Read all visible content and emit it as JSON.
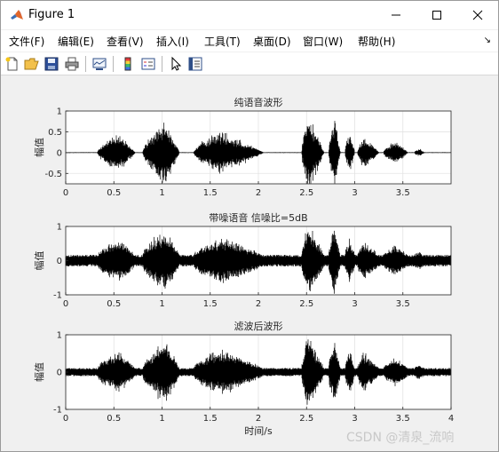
{
  "window": {
    "title": "Figure 1"
  },
  "menu": {
    "items": [
      "文件(F)",
      "编辑(E)",
      "查看(V)",
      "插入(I)",
      "工具(T)",
      "桌面(D)",
      "窗口(W)",
      "帮助(H)"
    ]
  },
  "toolbar": {
    "icons": [
      "new-figure-icon",
      "open-file-icon",
      "save-icon",
      "print-icon",
      "link-plot-icon",
      "insert-colorbar-icon",
      "insert-legend-icon",
      "pointer-icon",
      "property-inspector-icon"
    ]
  },
  "watermark": "CSDN @清泉_流响",
  "chart_data": [
    {
      "type": "line",
      "title": "纯语音波形",
      "xlabel": "",
      "ylabel": "幅值",
      "xlim": [
        0,
        4
      ],
      "ylim": [
        -0.75,
        1
      ],
      "xticks": [
        "0",
        "0.5",
        "1",
        "1.5",
        "2",
        "2.5",
        "3",
        "3.5"
      ],
      "yticks": [
        "1",
        "0.5",
        "0",
        "-0.5"
      ],
      "grid": true,
      "color": "#000000",
      "series": [
        {
          "noise": 0.01,
          "segments": [
            {
              "x": [
                0.33,
                0.72
              ],
              "amp": 0.5,
              "peak": 0.55
            },
            {
              "x": [
                0.8,
                1.18
              ],
              "amp": 0.8,
              "peak": 0.62
            },
            {
              "x": [
                1.33,
                2.05
              ],
              "amp": 0.55,
              "peak": 0.4
            },
            {
              "x": [
                2.45,
                2.68
              ],
              "amp": 0.98,
              "peak": 0.3
            },
            {
              "x": [
                2.73,
                2.85
              ],
              "amp": 0.9,
              "peak": 0.5
            },
            {
              "x": [
                2.9,
                3.0
              ],
              "amp": 0.55,
              "peak": 0.5
            },
            {
              "x": [
                3.03,
                3.25
              ],
              "amp": 0.45,
              "peak": 0.3
            },
            {
              "x": [
                3.3,
                3.55
              ],
              "amp": 0.3,
              "peak": 0.5
            },
            {
              "x": [
                3.62,
                3.72
              ],
              "amp": 0.1,
              "peak": 0.5
            }
          ]
        }
      ]
    },
    {
      "type": "line",
      "title": "带噪语音 信噪比=5dB",
      "xlabel": "",
      "ylabel": "幅值",
      "xlim": [
        0,
        4
      ],
      "ylim": [
        -1,
        1
      ],
      "xticks": [
        "0",
        "0.5",
        "1",
        "1.5",
        "2",
        "2.5",
        "3",
        "3.5"
      ],
      "yticks": [
        "1",
        "0",
        "-1"
      ],
      "grid": true,
      "color": "#000000",
      "series": [
        {
          "noise": 0.17,
          "segments": [
            {
              "x": [
                0.33,
                0.72
              ],
              "amp": 0.5,
              "peak": 0.55
            },
            {
              "x": [
                0.8,
                1.18
              ],
              "amp": 0.8,
              "peak": 0.62
            },
            {
              "x": [
                1.33,
                2.05
              ],
              "amp": 0.55,
              "peak": 0.4
            },
            {
              "x": [
                2.45,
                2.68
              ],
              "amp": 0.98,
              "peak": 0.3
            },
            {
              "x": [
                2.73,
                2.85
              ],
              "amp": 0.9,
              "peak": 0.5
            },
            {
              "x": [
                2.9,
                3.0
              ],
              "amp": 0.55,
              "peak": 0.5
            },
            {
              "x": [
                3.03,
                3.25
              ],
              "amp": 0.45,
              "peak": 0.3
            },
            {
              "x": [
                3.3,
                3.55
              ],
              "amp": 0.3,
              "peak": 0.5
            },
            {
              "x": [
                3.62,
                3.72
              ],
              "amp": 0.1,
              "peak": 0.5
            }
          ]
        }
      ]
    },
    {
      "type": "line",
      "title": "滤波后波形",
      "xlabel": "时间/s",
      "ylabel": "幅值",
      "xlim": [
        0,
        4
      ],
      "ylim": [
        -1,
        1
      ],
      "xticks": [
        "0",
        "0.5",
        "1",
        "1.5",
        "2",
        "2.5",
        "3",
        "3.5",
        "4"
      ],
      "yticks": [
        "1",
        "0",
        "-1"
      ],
      "grid": true,
      "color": "#000000",
      "series": [
        {
          "noise": 0.11,
          "segments": [
            {
              "x": [
                0.33,
                0.72
              ],
              "amp": 0.5,
              "peak": 0.55
            },
            {
              "x": [
                0.8,
                1.18
              ],
              "amp": 0.8,
              "peak": 0.62
            },
            {
              "x": [
                1.33,
                2.05
              ],
              "amp": 0.55,
              "peak": 0.4
            },
            {
              "x": [
                2.45,
                2.68
              ],
              "amp": 0.98,
              "peak": 0.3
            },
            {
              "x": [
                2.73,
                2.85
              ],
              "amp": 0.9,
              "peak": 0.5
            },
            {
              "x": [
                2.9,
                3.0
              ],
              "amp": 0.55,
              "peak": 0.5
            },
            {
              "x": [
                3.03,
                3.25
              ],
              "amp": 0.45,
              "peak": 0.3
            },
            {
              "x": [
                3.3,
                3.55
              ],
              "amp": 0.3,
              "peak": 0.5
            },
            {
              "x": [
                3.62,
                3.72
              ],
              "amp": 0.1,
              "peak": 0.5
            }
          ]
        }
      ]
    }
  ]
}
